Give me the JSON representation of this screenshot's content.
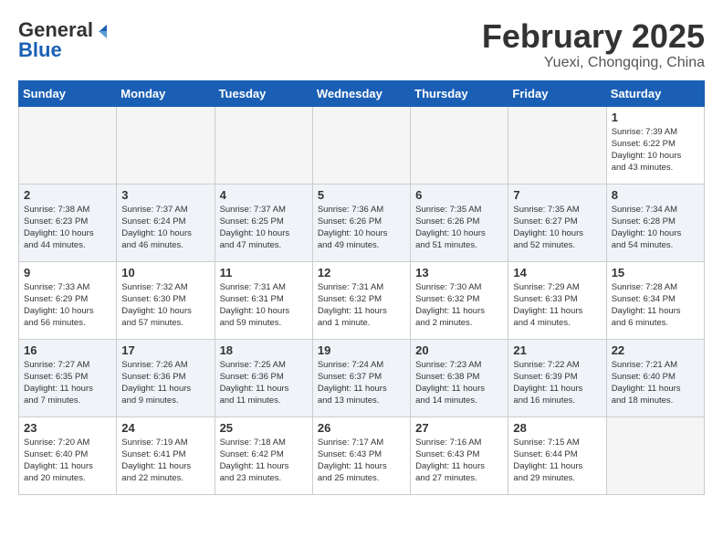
{
  "header": {
    "logo_line1": "General",
    "logo_line2": "Blue",
    "title": "February 2025",
    "subtitle": "Yuexi, Chongqing, China"
  },
  "weekdays": [
    "Sunday",
    "Monday",
    "Tuesday",
    "Wednesday",
    "Thursday",
    "Friday",
    "Saturday"
  ],
  "weeks": [
    {
      "alt": false,
      "days": [
        {
          "num": "",
          "info": ""
        },
        {
          "num": "",
          "info": ""
        },
        {
          "num": "",
          "info": ""
        },
        {
          "num": "",
          "info": ""
        },
        {
          "num": "",
          "info": ""
        },
        {
          "num": "",
          "info": ""
        },
        {
          "num": "1",
          "info": "Sunrise: 7:39 AM\nSunset: 6:22 PM\nDaylight: 10 hours\nand 43 minutes."
        }
      ]
    },
    {
      "alt": true,
      "days": [
        {
          "num": "2",
          "info": "Sunrise: 7:38 AM\nSunset: 6:23 PM\nDaylight: 10 hours\nand 44 minutes."
        },
        {
          "num": "3",
          "info": "Sunrise: 7:37 AM\nSunset: 6:24 PM\nDaylight: 10 hours\nand 46 minutes."
        },
        {
          "num": "4",
          "info": "Sunrise: 7:37 AM\nSunset: 6:25 PM\nDaylight: 10 hours\nand 47 minutes."
        },
        {
          "num": "5",
          "info": "Sunrise: 7:36 AM\nSunset: 6:26 PM\nDaylight: 10 hours\nand 49 minutes."
        },
        {
          "num": "6",
          "info": "Sunrise: 7:35 AM\nSunset: 6:26 PM\nDaylight: 10 hours\nand 51 minutes."
        },
        {
          "num": "7",
          "info": "Sunrise: 7:35 AM\nSunset: 6:27 PM\nDaylight: 10 hours\nand 52 minutes."
        },
        {
          "num": "8",
          "info": "Sunrise: 7:34 AM\nSunset: 6:28 PM\nDaylight: 10 hours\nand 54 minutes."
        }
      ]
    },
    {
      "alt": false,
      "days": [
        {
          "num": "9",
          "info": "Sunrise: 7:33 AM\nSunset: 6:29 PM\nDaylight: 10 hours\nand 56 minutes."
        },
        {
          "num": "10",
          "info": "Sunrise: 7:32 AM\nSunset: 6:30 PM\nDaylight: 10 hours\nand 57 minutes."
        },
        {
          "num": "11",
          "info": "Sunrise: 7:31 AM\nSunset: 6:31 PM\nDaylight: 10 hours\nand 59 minutes."
        },
        {
          "num": "12",
          "info": "Sunrise: 7:31 AM\nSunset: 6:32 PM\nDaylight: 11 hours\nand 1 minute."
        },
        {
          "num": "13",
          "info": "Sunrise: 7:30 AM\nSunset: 6:32 PM\nDaylight: 11 hours\nand 2 minutes."
        },
        {
          "num": "14",
          "info": "Sunrise: 7:29 AM\nSunset: 6:33 PM\nDaylight: 11 hours\nand 4 minutes."
        },
        {
          "num": "15",
          "info": "Sunrise: 7:28 AM\nSunset: 6:34 PM\nDaylight: 11 hours\nand 6 minutes."
        }
      ]
    },
    {
      "alt": true,
      "days": [
        {
          "num": "16",
          "info": "Sunrise: 7:27 AM\nSunset: 6:35 PM\nDaylight: 11 hours\nand 7 minutes."
        },
        {
          "num": "17",
          "info": "Sunrise: 7:26 AM\nSunset: 6:36 PM\nDaylight: 11 hours\nand 9 minutes."
        },
        {
          "num": "18",
          "info": "Sunrise: 7:25 AM\nSunset: 6:36 PM\nDaylight: 11 hours\nand 11 minutes."
        },
        {
          "num": "19",
          "info": "Sunrise: 7:24 AM\nSunset: 6:37 PM\nDaylight: 11 hours\nand 13 minutes."
        },
        {
          "num": "20",
          "info": "Sunrise: 7:23 AM\nSunset: 6:38 PM\nDaylight: 11 hours\nand 14 minutes."
        },
        {
          "num": "21",
          "info": "Sunrise: 7:22 AM\nSunset: 6:39 PM\nDaylight: 11 hours\nand 16 minutes."
        },
        {
          "num": "22",
          "info": "Sunrise: 7:21 AM\nSunset: 6:40 PM\nDaylight: 11 hours\nand 18 minutes."
        }
      ]
    },
    {
      "alt": false,
      "days": [
        {
          "num": "23",
          "info": "Sunrise: 7:20 AM\nSunset: 6:40 PM\nDaylight: 11 hours\nand 20 minutes."
        },
        {
          "num": "24",
          "info": "Sunrise: 7:19 AM\nSunset: 6:41 PM\nDaylight: 11 hours\nand 22 minutes."
        },
        {
          "num": "25",
          "info": "Sunrise: 7:18 AM\nSunset: 6:42 PM\nDaylight: 11 hours\nand 23 minutes."
        },
        {
          "num": "26",
          "info": "Sunrise: 7:17 AM\nSunset: 6:43 PM\nDaylight: 11 hours\nand 25 minutes."
        },
        {
          "num": "27",
          "info": "Sunrise: 7:16 AM\nSunset: 6:43 PM\nDaylight: 11 hours\nand 27 minutes."
        },
        {
          "num": "28",
          "info": "Sunrise: 7:15 AM\nSunset: 6:44 PM\nDaylight: 11 hours\nand 29 minutes."
        },
        {
          "num": "",
          "info": ""
        }
      ]
    }
  ]
}
